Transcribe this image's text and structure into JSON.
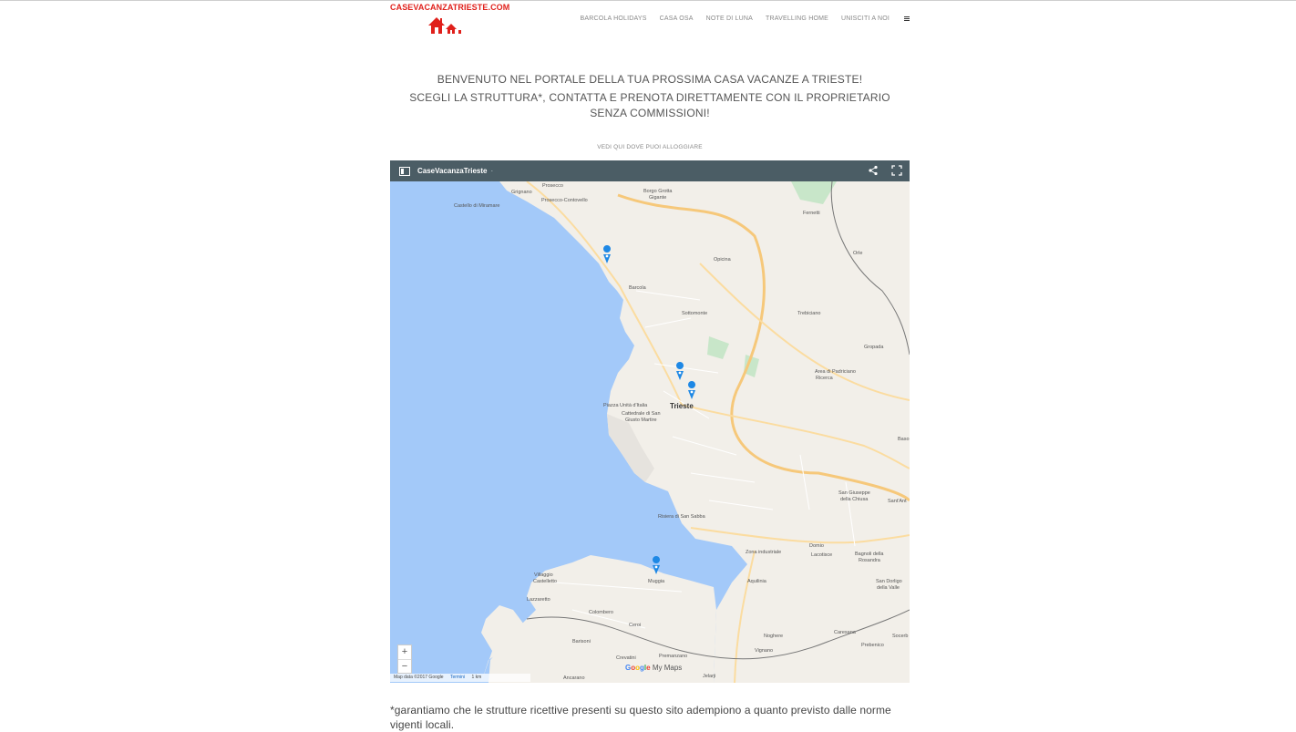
{
  "site": {
    "logo_text": "CASEVACANZATRIESTE.COM",
    "brand_color": "#e0201b"
  },
  "nav": {
    "items": [
      {
        "label": "BARCOLA HOLIDAYS"
      },
      {
        "label": "CASA OSA"
      },
      {
        "label": "NOTE DI LUNA"
      },
      {
        "label": "TRAVELLING HOME"
      },
      {
        "label": "UNISCITI A NOI"
      }
    ],
    "menu_icon": "hamburger-icon"
  },
  "hero": {
    "line1": "BENVENUTO NEL PORTALE DELLA TUA PROSSIMA CASA VACANZE A TRIESTE!",
    "line2": "SCEGLI LA STRUTTURA*, CONTATTA E PRENOTA DIRETTAMENTE CON IL PROPRIETARIO SENZA COMMISSIONI!"
  },
  "map": {
    "caption": "VEDI QUI DOVE PUOI ALLOGGIARE",
    "title": "CaseVacanzaTrieste",
    "zoom_in": "+",
    "zoom_out": "−",
    "attribution": "Map data ©2017 Google",
    "terms": "Termini",
    "scale": "1 km",
    "brand_suffix": "My Maps",
    "sea_color": "#a3c9f9",
    "land_color": "#f2efe9",
    "pin_color": "#1e88e5",
    "labels": {
      "prosecco": "Prosecco",
      "borgo_grotta": "Borgo Grotta",
      "gigante": "Gigante",
      "prosecco_contovello": "Prosecco-Contovello",
      "grignano": "Grignano",
      "castello": "Castello di Miramare",
      "fernetti": "Fernetti",
      "opicina": "Opicina",
      "orle": "Orle",
      "barcola": "Barcola",
      "sottomonte": "Sottomonte",
      "trebiciano": "Trebiciano",
      "gropada": "Gropada",
      "padriciano": "Area di Padriciano",
      "ricerca": "Ricerca",
      "piazza": "Piazza Unità d'Italia",
      "cattedrale1": "Cattedrale di San",
      "cattedrale2": "Giusto Martire",
      "trieste": "Trieste",
      "san_giuseppe1": "San Giuseppe",
      "san_giuseppe2": "della Chiusa",
      "risiera": "Risiera di San Sabba",
      "zona": "Zona industriale",
      "aquilinia": "Aquilinia",
      "domio": "Domio",
      "lacotisce": "Lacotisce",
      "bagnoli1": "Bagnoli della",
      "bagnoli2": "Rosandra",
      "san_dorligo1": "San Dorligo",
      "san_dorligo2": "della Valle",
      "villaggio1": "Villaggio",
      "villaggio2": "Castelletto",
      "muggia": "Muggia",
      "lazzaretto": "Lazzaretto",
      "colombero": "Colombero",
      "ceroi": "Ceroi",
      "barisoni": "Barisoni",
      "noghere": "Noghere",
      "caresana": "Caresana",
      "prebenico": "Prebenico",
      "crevatini": "Crevatini",
      "premanzano": "Premanzano",
      "vignano": "Vignano",
      "ancarano": "Ancarano",
      "jelarji": "Jelarji",
      "basovizza": "Baso",
      "sant_antonio": "Sant'Ant",
      "socerb": "Socerb"
    }
  },
  "footnote": {
    "text": "*garantiamo che le strutture ricettive presenti su questo sito adempiono a quanto previsto dalle norme vigenti locali."
  }
}
